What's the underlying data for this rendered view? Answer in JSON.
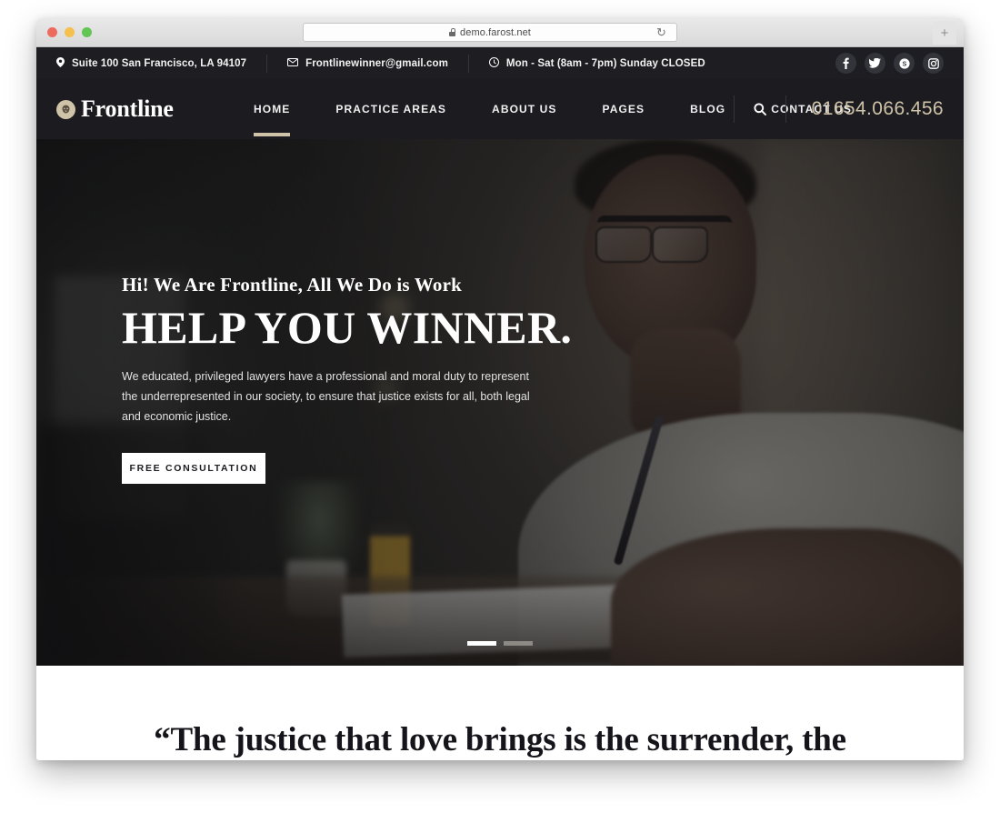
{
  "browser": {
    "url": "demo.farost.net",
    "lock_icon": "lock-icon",
    "reload_icon": "↻",
    "new_tab_label": "+",
    "traffic_lights": [
      "close",
      "minimize",
      "maximize"
    ]
  },
  "topbar": {
    "items": [
      {
        "icon": "location-pin-icon",
        "glyph": "⚲",
        "text": "Suite 100 San Francisco, LA 94107"
      },
      {
        "icon": "envelope-icon",
        "glyph": "✉",
        "text": "Frontlinewinner@gmail.com"
      },
      {
        "icon": "clock-icon",
        "glyph": "🕐",
        "text": "Mon - Sat (8am - 7pm) Sunday CLOSED"
      }
    ],
    "socials": [
      {
        "name": "facebook-icon",
        "glyph": "f"
      },
      {
        "name": "twitter-icon",
        "glyph": "t"
      },
      {
        "name": "skype-icon",
        "glyph": "S"
      },
      {
        "name": "instagram-icon",
        "glyph": "◙"
      }
    ]
  },
  "nav": {
    "logo_text": "Frontline",
    "logo_emblem_icon": "lion-emblem-icon",
    "menu": [
      {
        "label": "HOME",
        "active": true
      },
      {
        "label": "PRACTICE AREAS",
        "active": false
      },
      {
        "label": "ABOUT US",
        "active": false
      },
      {
        "label": "PAGES",
        "active": false
      },
      {
        "label": "BLOG",
        "active": false
      },
      {
        "label": "CONTACT US",
        "active": false
      }
    ],
    "search_icon": "search-icon",
    "phone": "01654.066.456",
    "accent_color": "#cfc3a8",
    "bar_color": "#1b1b20"
  },
  "hero": {
    "kicker": "Hi! We Are Frontline, All We Do is Work",
    "title": "HELP YOU WINNER.",
    "description": "We educated, privileged lawyers have a professional and moral duty to represent the underrepresented in our society, to ensure that justice exists for all, both legal and economic justice.",
    "cta_label": "FREE CONSULTATION",
    "slides": [
      {
        "index": 1,
        "active": true
      },
      {
        "index": 2,
        "active": false
      }
    ]
  },
  "quote": {
    "text": "“The justice that love brings is the surrender, the"
  }
}
